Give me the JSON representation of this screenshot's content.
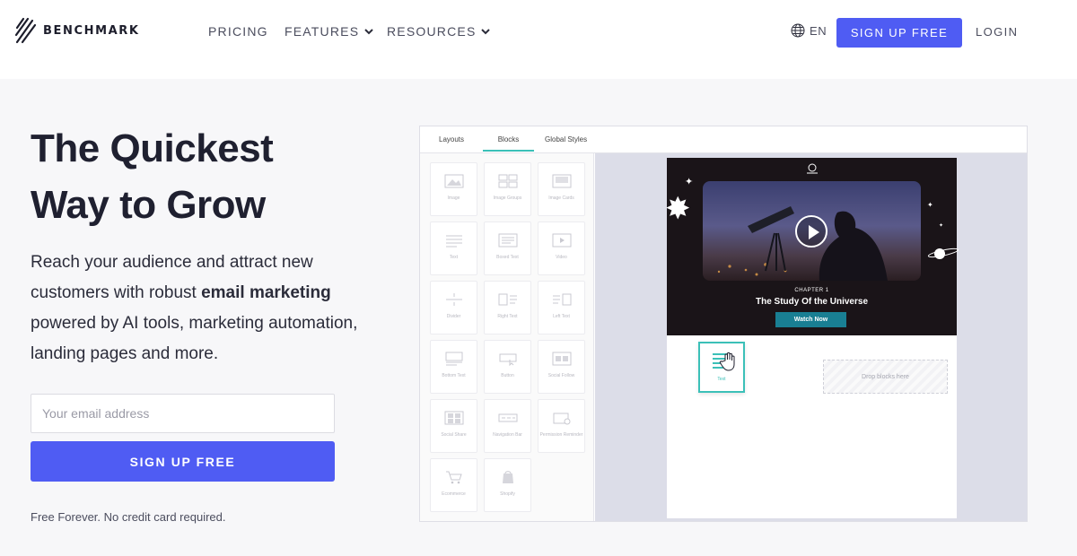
{
  "nav": {
    "brand": "BENCHMARK",
    "links": [
      {
        "label": "PRICING",
        "dropdown": false
      },
      {
        "label": "FEATURES",
        "dropdown": true
      },
      {
        "label": "RESOURCES",
        "dropdown": true
      }
    ],
    "language": "EN",
    "signup_label": "SIGN UP FREE",
    "login_label": "LOGIN"
  },
  "hero": {
    "headline_line1": "The Quickest",
    "headline_line2": "Way to Grow",
    "sub_part1": "Reach your audience and attract new customers with robust ",
    "sub_bold": "email marketing",
    "sub_part2": " powered by AI tools, marketing automation, landing pages and more.",
    "email_placeholder": "Your email address",
    "signup_label": "SIGN UP FREE",
    "fineprint": "Free Forever. No credit card required."
  },
  "editor": {
    "tabs": [
      {
        "label": "Layouts",
        "active": false
      },
      {
        "label": "Blocks",
        "active": true
      },
      {
        "label": "Global Styles",
        "active": false
      }
    ],
    "blocks": [
      {
        "label": "Image",
        "icon": "image-icon"
      },
      {
        "label": "Image Groups",
        "icon": "image-group-icon"
      },
      {
        "label": "Image Cards",
        "icon": "image-card-icon"
      },
      {
        "label": "Text",
        "icon": "text-icon"
      },
      {
        "label": "Boxed Text",
        "icon": "boxed-text-icon"
      },
      {
        "label": "Video",
        "icon": "video-icon"
      },
      {
        "label": "Divider",
        "icon": "divider-icon"
      },
      {
        "label": "Right Text",
        "icon": "right-text-icon"
      },
      {
        "label": "Left Text",
        "icon": "left-text-icon"
      },
      {
        "label": "Bottom Text",
        "icon": "bottom-text-icon"
      },
      {
        "label": "Button",
        "icon": "button-icon"
      },
      {
        "label": "Social Follow",
        "icon": "social-follow-icon"
      },
      {
        "label": "Social Share",
        "icon": "social-share-icon"
      },
      {
        "label": "Navigation Bar",
        "icon": "navigation-bar-icon"
      },
      {
        "label": "Permission Reminder",
        "icon": "permission-reminder-icon"
      },
      {
        "label": "Ecommerce",
        "icon": "cart-icon"
      },
      {
        "label": "Shopify",
        "icon": "shopify-icon"
      }
    ],
    "preview": {
      "chapter": "CHAPTER 1",
      "title": "The Study Of the Universe",
      "cta": "Watch Now"
    },
    "dragging_block_label": "Text",
    "drop_zone_label": "Drop blocks here"
  },
  "colors": {
    "accent": "#4f5cf3",
    "teal": "#3bc0b8",
    "cta_teal": "#197f93"
  }
}
